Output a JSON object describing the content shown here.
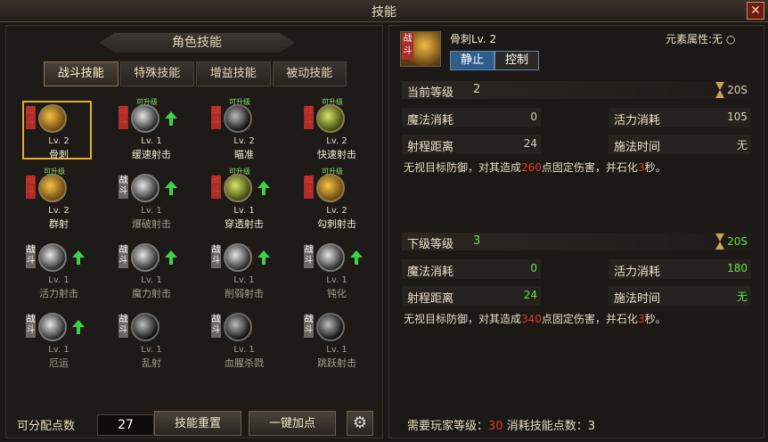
{
  "window": {
    "title": "技能"
  },
  "left": {
    "banner": "角色技能",
    "tabs": [
      "战斗技能",
      "特殊技能",
      "增益技能",
      "被动技能"
    ],
    "skills": [
      {
        "lv": "Lv. 2",
        "name": "骨刺",
        "tag": "战斗",
        "grade": "",
        "upgradable": false
      },
      {
        "lv": "Lv. 1",
        "name": "缓速射击",
        "tag": "战斗",
        "grade": "可升级",
        "upgradable": true
      },
      {
        "lv": "Lv. 2",
        "name": "瞄准",
        "tag": "战斗",
        "grade": "可升级",
        "upgradable": false
      },
      {
        "lv": "Lv. 2",
        "name": "快速射击",
        "tag": "战斗",
        "grade": "可升级",
        "upgradable": false
      },
      {
        "lv": "Lv. 2",
        "name": "群射",
        "tag": "战斗",
        "grade": "可升级",
        "upgradable": false
      },
      {
        "lv": "Lv. 1",
        "name": "爆破射击",
        "tag": "战斗",
        "grade": "",
        "upgradable": true
      },
      {
        "lv": "Lv. 1",
        "name": "穿透射击",
        "tag": "战斗",
        "grade": "可升级",
        "upgradable": true
      },
      {
        "lv": "Lv. 2",
        "name": "勾刺射击",
        "tag": "战斗",
        "grade": "可升级",
        "upgradable": false
      },
      {
        "lv": "Lv. 1",
        "name": "活力射击",
        "tag": "战斗",
        "grade": "",
        "upgradable": true
      },
      {
        "lv": "Lv. 1",
        "name": "魔力射击",
        "tag": "战斗",
        "grade": "",
        "upgradable": true
      },
      {
        "lv": "Lv. 1",
        "name": "削弱射击",
        "tag": "战斗",
        "grade": "",
        "upgradable": true
      },
      {
        "lv": "Lv. 1",
        "name": "钝化",
        "tag": "战斗",
        "grade": "",
        "upgradable": true
      },
      {
        "lv": "Lv. 1",
        "name": "厄运",
        "tag": "战斗",
        "grade": "",
        "upgradable": true
      },
      {
        "lv": "Lv. 1",
        "name": "乱射",
        "tag": "战斗",
        "grade": "",
        "upgradable": false
      },
      {
        "lv": "Lv. 1",
        "name": "血腥杀戮",
        "tag": "战斗",
        "grade": "",
        "upgradable": false
      },
      {
        "lv": "Lv. 1",
        "name": "跳跃射击",
        "tag": "战斗",
        "grade": "",
        "upgradable": false
      }
    ],
    "points_label": "可分配点数",
    "points_value": "27",
    "reset_button": "技能重置",
    "auto_button": "一键加点"
  },
  "right": {
    "skill_tag": "战斗",
    "skill_name": "骨刺Lv. 2",
    "element_label": "元素属性:无",
    "chips": [
      "静止",
      "控制"
    ],
    "current": {
      "label": "当前等级",
      "level": "2",
      "time": "20S",
      "mp_label": "魔法消耗",
      "mp": "0",
      "sp_label": "活力消耗",
      "sp": "105",
      "range_label": "射程距离",
      "range": "24",
      "cast_label": "施法时间",
      "cast": "无",
      "desc_a": "无视目标防御，对其造成",
      "desc_dmg": "260",
      "desc_b": "点固定伤害，并石化",
      "desc_sec": "3",
      "desc_c": "秒。"
    },
    "next": {
      "label": "下级等级",
      "level": "3",
      "time": "20S",
      "mp_label": "魔法消耗",
      "mp": "0",
      "sp_label": "活力消耗",
      "sp": "180",
      "range_label": "射程距离",
      "range": "24",
      "cast_label": "施法时间",
      "cast": "无",
      "desc_a": "无视目标防御，对其造成",
      "desc_dmg": "340",
      "desc_b": "点固定伤害，并石化",
      "desc_sec": "3",
      "desc_c": "秒。"
    },
    "req_a": "需要玩家等级：",
    "req_level": "30",
    "req_b": " 消耗技能点数：",
    "req_points": "3"
  },
  "colors": {
    "accent_gold": "#e4ad2c",
    "damage_red": "#e2382d",
    "next_green": "#5fe347"
  }
}
